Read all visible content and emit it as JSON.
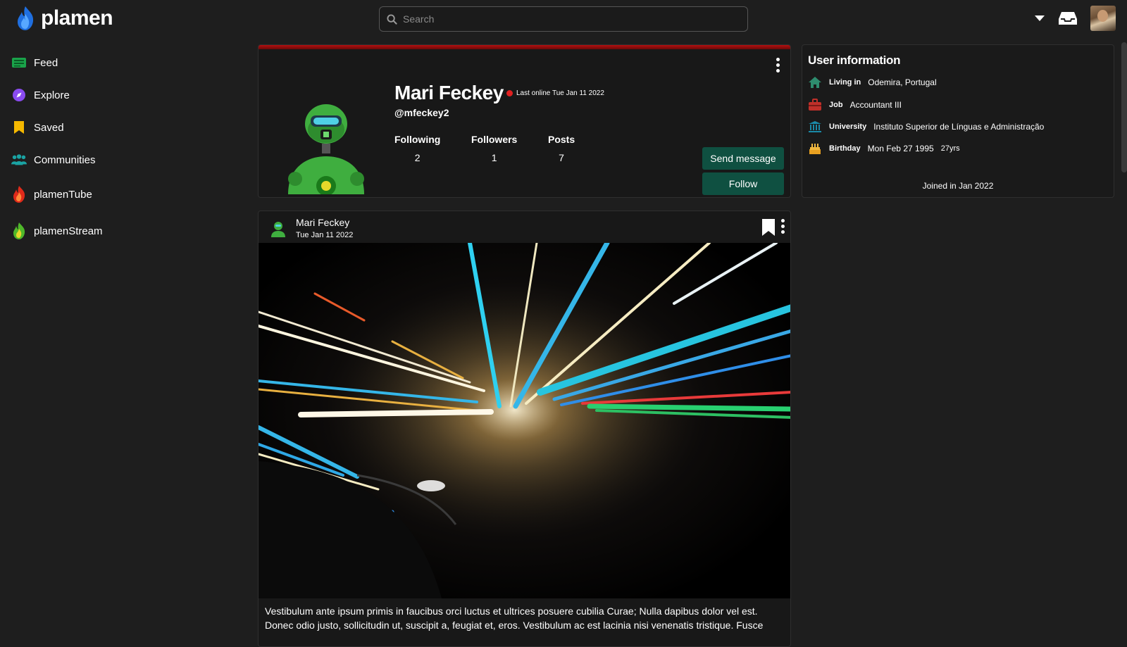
{
  "app": {
    "name": "plamen"
  },
  "search": {
    "placeholder": "Search"
  },
  "sidebar": {
    "items": [
      {
        "label": "Feed",
        "icon": "feed-icon"
      },
      {
        "label": "Explore",
        "icon": "compass-icon"
      },
      {
        "label": "Saved",
        "icon": "bookmark-icon"
      },
      {
        "label": "Communities",
        "icon": "users-icon"
      },
      {
        "label": "plamenTube",
        "icon": "flame-red-icon"
      },
      {
        "label": "plamenStream",
        "icon": "flame-green-icon"
      }
    ]
  },
  "profile": {
    "name": "Mari Feckey",
    "last_online": "Last online Tue Jan 11 2022",
    "handle": "@mfeckey2",
    "stats": [
      {
        "label": "Following",
        "value": "2"
      },
      {
        "label": "Followers",
        "value": "1"
      },
      {
        "label": "Posts",
        "value": "7"
      }
    ],
    "send_message": "Send message",
    "follow": "Follow"
  },
  "user_info": {
    "title": "User information",
    "rows": [
      {
        "key": "Living in",
        "value": "Odemira, Portugal",
        "icon": "home-icon"
      },
      {
        "key": "Job",
        "value": "Accountant III",
        "icon": "briefcase-icon"
      },
      {
        "key": "University",
        "value": "Instituto Superior de Línguas e Administração",
        "icon": "university-icon"
      },
      {
        "key": "Birthday",
        "value": "Mon Feb 27 1995",
        "extra": "27yrs",
        "icon": "cake-icon"
      }
    ],
    "joined": "Joined in Jan 2022"
  },
  "post": {
    "author": "Mari Feckey",
    "date": "Tue Jan 11 2022",
    "text": "Vestibulum ante ipsum primis in faucibus orci luctus et ultrices posuere cubilia Curae; Nulla dapibus dolor vel est. Donec odio justo, sollicitudin ut, suscipit a, feugiat et, eros. Vestibulum ac est lacinia nisi venenatis tristique. Fusce"
  },
  "colors": {
    "accent_button": "#0f5041",
    "profile_bar": "#b31010",
    "status_offline": "#e02020"
  }
}
